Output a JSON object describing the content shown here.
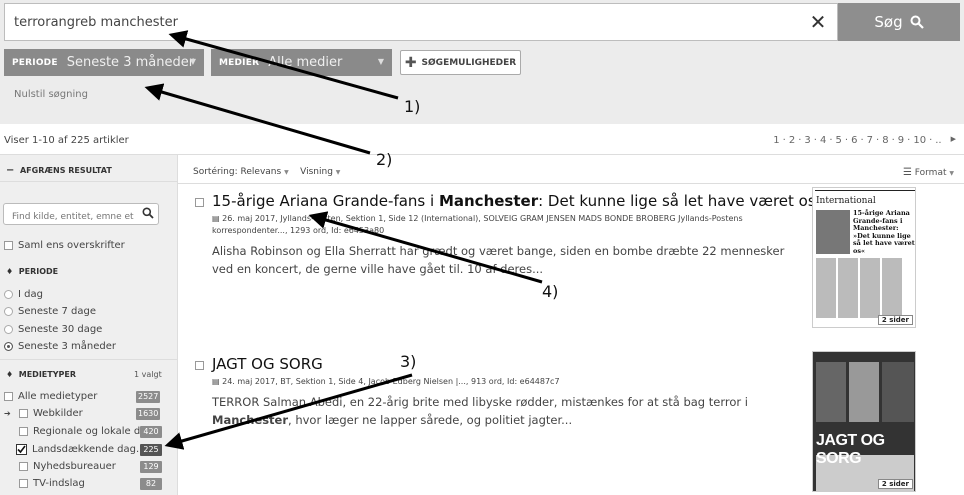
{
  "search": {
    "query": "terrorangreb manchester",
    "submit_label": "Søg"
  },
  "filters": {
    "periode_label": "PERIODE",
    "periode_value": "Seneste 3 måneder",
    "medier_label": "MEDIER",
    "medier_value": "Alle medier",
    "options_label": "SØGEMULIGHEDER",
    "reset_label": "Nulstil søgning"
  },
  "results": {
    "count_text": "Viser 1-10 af 225 artikler",
    "pages": [
      "1",
      "2",
      "3",
      "4",
      "5",
      "6",
      "7",
      "8",
      "9",
      "10",
      ".."
    ],
    "sort_label": "Sortéring:",
    "sort_value": "Relevans",
    "view_label": "Visning",
    "format_label": "Format"
  },
  "sidebar": {
    "header": "AFGRÆNS RESULTAT",
    "search_placeholder": "Find kilde, entitet, emne etc.",
    "merge_label": "Saml ens overskrifter",
    "periode_header": "PERIODE",
    "periods": [
      "I dag",
      "Seneste 7 dage",
      "Seneste 30 dage",
      "Seneste 3 måneder"
    ],
    "medietyper_header": "MEDIETYPER",
    "medietyper_selected": "1 valgt",
    "medietyper": [
      {
        "label": "Alle medietyper",
        "count": "2527"
      },
      {
        "label": "Webkilder",
        "count": "1630"
      },
      {
        "label": "Regionale og lokale d...",
        "count": "420"
      },
      {
        "label": "Landsdækkende dag...",
        "count": "225"
      },
      {
        "label": "Nyhedsbureauer",
        "count": "129"
      },
      {
        "label": "TV-indslag",
        "count": "82"
      }
    ]
  },
  "articles": [
    {
      "title_pre": "15-årige Ariana Grande-fans i ",
      "title_bold": "Manchester",
      "title_post": ": Det kunne lige så let have været os",
      "meta": "26. maj 2017, Jyllands-Posten, Sektion 1, Side 12 (International), SOLVEIG GRAM JENSEN MADS BONDE BROBERG Jyllands-Postens korrespondenter..., 1293 ord, Id: e6453a80",
      "snippet": "Alisha Robinson og Ella Sherratt har grædt og været bange, siden en bombe dræbte 22 mennesker ved en koncert, de gerne ville have gået til. 10 af deres...",
      "thumb_head": "International",
      "thumb_title": "15-årige Ariana Grande-fans i Manchester: »Det kunne lige så let have været os«",
      "pages_tag": "2 sider"
    },
    {
      "title_pre": "JAGT OG SORG",
      "meta": "24. maj 2017, BT, Sektion 1, Side 4, Jacob Edberg Nielsen |..., 913 ord, Id: e64487c7",
      "snippet_pre": "TERROR Salman Abedi, en 22-årig brite med libyske rødder, mistænkes for at stå bag terror i ",
      "snippet_bold": "Manchester",
      "snippet_post": ", hvor læger ne lapper sårede, og politiet jagter...",
      "thumb_title": "JAGT OG SORG",
      "pages_tag": "2 sider"
    }
  ],
  "annotations": [
    "1)",
    "2)",
    "3)",
    "4)"
  ]
}
